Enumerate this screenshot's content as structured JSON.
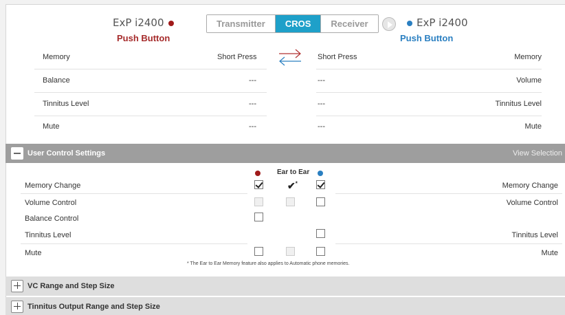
{
  "header": {
    "left_device": "ExP i2400",
    "right_device": "ExP i2400",
    "left_title": "Push Button",
    "right_title": "Push Button",
    "modes": [
      "Transmitter",
      "CROS",
      "Receiver"
    ],
    "active_mode": "CROS",
    "colors": {
      "left": "#a01a1a",
      "right": "#2a7fc1",
      "accent": "#1ea0c9"
    }
  },
  "push_button": {
    "rows": [
      {
        "left_label": "Memory",
        "left_value": "Short Press",
        "right_value": "Short Press",
        "right_label": "Memory"
      },
      {
        "left_label": "Balance",
        "left_value": "---",
        "right_value": "---",
        "right_label": "Volume"
      },
      {
        "left_label": "Tinnitus Level",
        "left_value": "---",
        "right_value": "---",
        "right_label": "Tinnitus Level"
      },
      {
        "left_label": "Mute",
        "left_value": "---",
        "right_value": "---",
        "right_label": "Mute"
      }
    ]
  },
  "ucs": {
    "title": "User Control Settings",
    "view_selection": "View Selection",
    "ear_to_ear": "Ear to Ear",
    "rows": [
      {
        "left_label": "Memory Change",
        "right_label": "Memory Change"
      },
      {
        "left_label": "Volume Control",
        "right_label": "Volume Control"
      },
      {
        "left_label": "Balance Control",
        "right_label": ""
      },
      {
        "left_label": "Tinnitus Level",
        "right_label": "Tinnitus Level"
      },
      {
        "left_label": "Mute",
        "right_label": "Mute"
      }
    ],
    "note": "* The Ear to Ear Memory feature also applies to Automatic phone memories."
  },
  "sections": {
    "vc_range": "VC Range and Step Size",
    "tinnitus_range": "Tinnitus Output Range and Step Size"
  }
}
